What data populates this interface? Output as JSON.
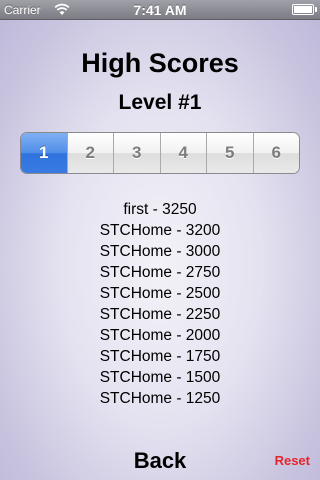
{
  "status_bar": {
    "carrier": "Carrier",
    "time": "7:41 AM",
    "battery_level": 1.0
  },
  "title": "High Scores",
  "subtitle": "Level #1",
  "level_tabs": {
    "labels": [
      "1",
      "2",
      "3",
      "4",
      "5",
      "6"
    ],
    "selected": "1",
    "selected_color": "#3a7be2"
  },
  "scores": [
    "first - 3250",
    "STCHome - 3200",
    "STCHome - 3000",
    "STCHome - 2750",
    "STCHome - 2500",
    "STCHome - 2250",
    "STCHome - 2000",
    "STCHome - 1750",
    "STCHome - 1500",
    "STCHome - 1250"
  ],
  "back_label": "Back",
  "reset_label": "Reset",
  "reset_color": "#e2262b",
  "icons": {
    "wifi": "wifi-icon",
    "battery": "battery-icon"
  }
}
